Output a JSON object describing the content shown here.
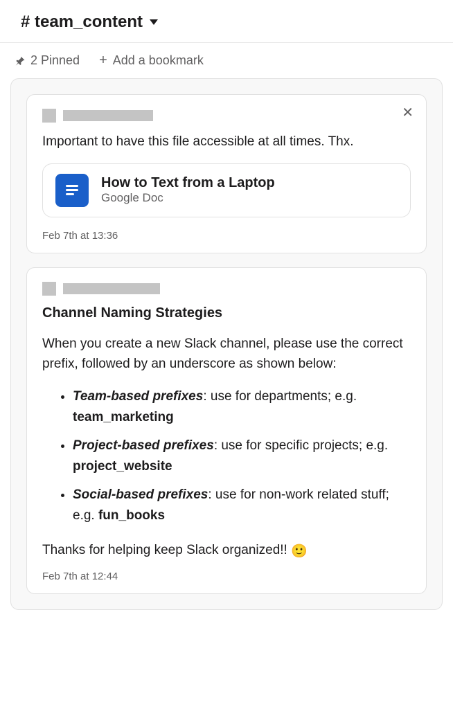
{
  "header": {
    "channel_name": "# team_content"
  },
  "toolbar": {
    "pinned_label": "2 Pinned",
    "bookmark_label": "Add a bookmark"
  },
  "pinned": [
    {
      "message": "Important to have this file accessible at all times. Thx.",
      "attachment": {
        "title": "How to Text from a Laptop",
        "subtitle": "Google Doc"
      },
      "timestamp": "Feb 7th at 13:36"
    },
    {
      "heading": "Channel Naming Strategies",
      "intro": "When you create a new Slack channel, please use the correct prefix, followed by an underscore as shown below:",
      "bullets": [
        {
          "prefix": "Team-based prefixes",
          "desc": ": use for departments; e.g. ",
          "example": "team_marketing"
        },
        {
          "prefix": "Project-based prefixes",
          "desc": ": use for specific projects; e.g. ",
          "example": "project_website"
        },
        {
          "prefix": "Social-based prefixes",
          "desc": ": use for non-work related stuff; e.g. ",
          "example": "fun_books"
        }
      ],
      "closing": "Thanks for helping keep Slack organized!! ",
      "emoji": "🙂",
      "timestamp": "Feb 7th at 12:44"
    }
  ]
}
